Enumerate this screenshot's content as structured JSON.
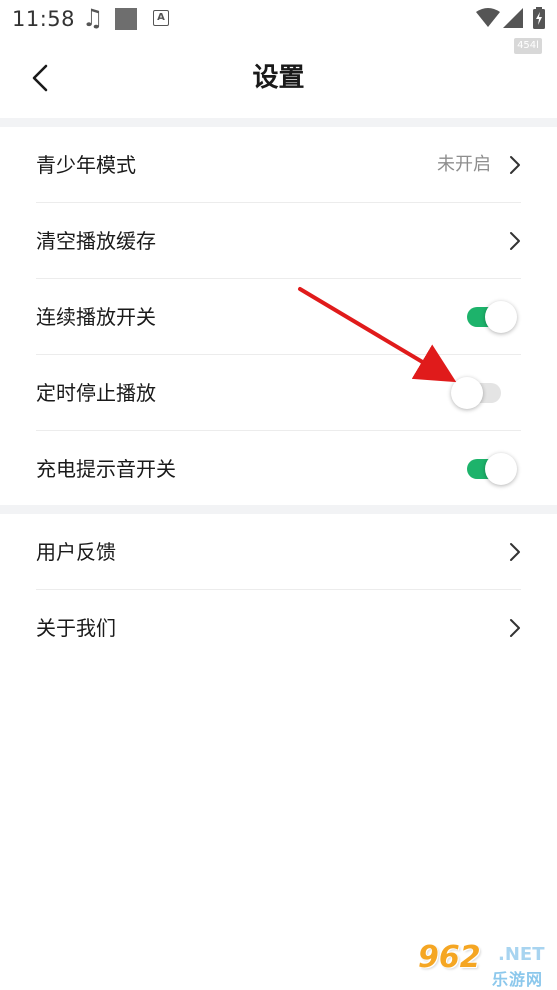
{
  "status_bar": {
    "time": "11:58",
    "note_glyph": "♫",
    "a_glyph": "A",
    "watermark_tag": "454l"
  },
  "header": {
    "title": "设置",
    "back_icon": "chevron-left-icon"
  },
  "section1": {
    "items": [
      {
        "label": "青少年模式",
        "value": "未开启",
        "control": "chevron"
      },
      {
        "label": "清空播放缓存",
        "control": "chevron"
      },
      {
        "label": "连续播放开关",
        "control": "toggle",
        "toggle_on": true
      },
      {
        "label": "定时停止播放",
        "control": "toggle",
        "toggle_on": false
      },
      {
        "label": "充电提示音开关",
        "control": "toggle",
        "toggle_on": true
      }
    ]
  },
  "section2": {
    "items": [
      {
        "label": "用户反馈",
        "control": "chevron"
      },
      {
        "label": "关于我们",
        "control": "chevron"
      }
    ]
  },
  "colors": {
    "accent_green": "#1db36b",
    "annotation_red": "#e01b1b",
    "section_gap": "#f2f3f5"
  },
  "watermark": {
    "num": "962",
    "net": ".NET",
    "cn": "乐游网"
  }
}
